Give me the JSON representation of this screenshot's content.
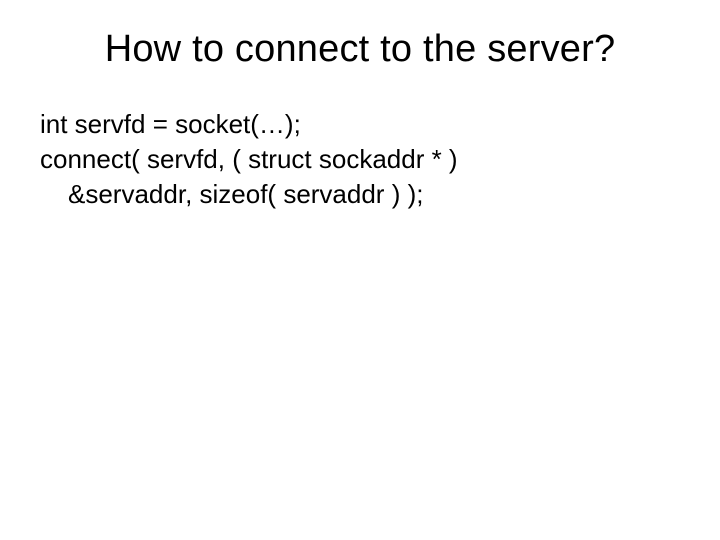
{
  "slide": {
    "title": "How to connect to the server?",
    "code": {
      "line1": "int servfd = socket(…);",
      "line2": "connect( servfd, ( struct sockaddr * )",
      "line3": "&servaddr, sizeof( servaddr ) );"
    }
  }
}
